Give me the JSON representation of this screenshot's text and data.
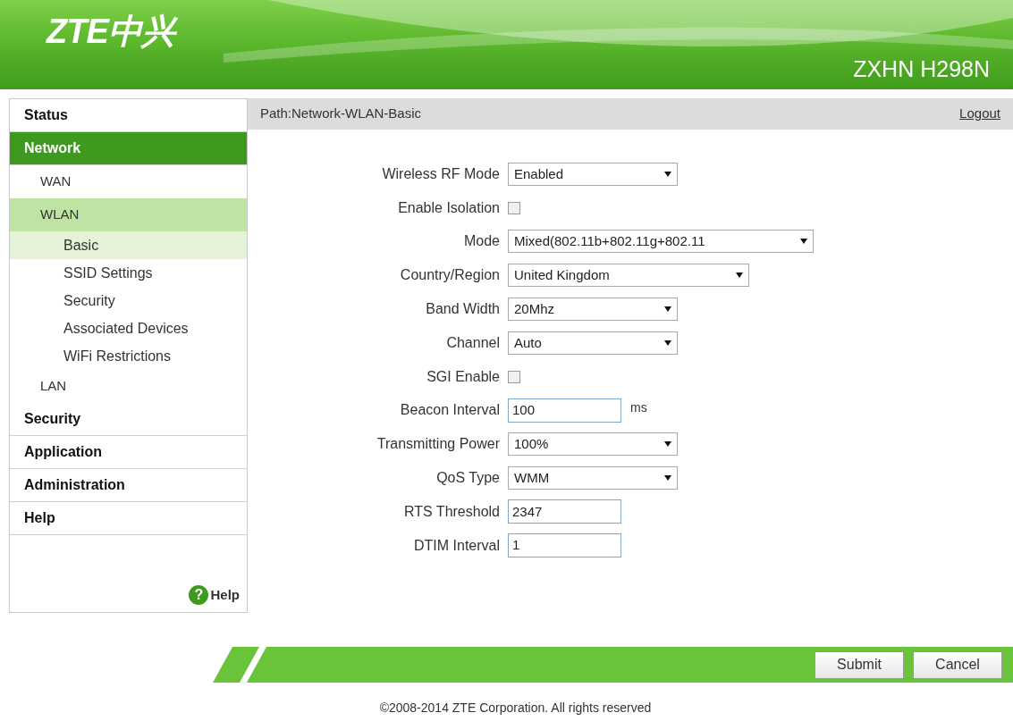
{
  "header": {
    "logo": "ZTE中兴",
    "model": "ZXHN H298N"
  },
  "sidebar": {
    "items": [
      {
        "label": "Status",
        "selected": false
      },
      {
        "label": "Network",
        "selected": true,
        "children": [
          {
            "label": "WAN",
            "selected": false
          },
          {
            "label": "WLAN",
            "selected": true,
            "children": [
              {
                "label": "Basic",
                "selected": true
              },
              {
                "label": "SSID Settings",
                "selected": false
              },
              {
                "label": "Security",
                "selected": false
              },
              {
                "label": "Associated Devices",
                "selected": false
              },
              {
                "label": "WiFi Restrictions",
                "selected": false
              }
            ]
          },
          {
            "label": "LAN",
            "selected": false
          }
        ]
      },
      {
        "label": "Security",
        "selected": false
      },
      {
        "label": "Application",
        "selected": false
      },
      {
        "label": "Administration",
        "selected": false
      },
      {
        "label": "Help",
        "selected": false
      }
    ],
    "help_link": {
      "glyph": "?",
      "label": "Help"
    }
  },
  "path_bar": {
    "path": "Path:Network-WLAN-Basic",
    "logout": "Logout"
  },
  "fields": [
    {
      "kind": "select",
      "label": "Wireless RF Mode",
      "value": "Enabled"
    },
    {
      "kind": "checkbox",
      "label": "Enable Isolation",
      "checked": false
    },
    {
      "kind": "select",
      "label": "Mode",
      "value": "Mixed(802.11b+802.11g+802.11"
    },
    {
      "kind": "select",
      "label": "Country/Region",
      "value": "United Kingdom"
    },
    {
      "kind": "select",
      "label": "Band Width",
      "value": "20Mhz"
    },
    {
      "kind": "select",
      "label": "Channel",
      "value": "Auto"
    },
    {
      "kind": "checkbox",
      "label": "SGI Enable",
      "checked": false
    },
    {
      "kind": "text",
      "label": "Beacon Interval",
      "value": "100",
      "unit": "ms"
    },
    {
      "kind": "select",
      "label": "Transmitting Power",
      "value": "100%"
    },
    {
      "kind": "select",
      "label": "QoS Type",
      "value": "WMM"
    },
    {
      "kind": "text",
      "label": "RTS Threshold",
      "value": "2347"
    },
    {
      "kind": "text",
      "label": "DTIM Interval",
      "value": "1"
    }
  ],
  "buttons": [
    "Submit",
    "Cancel"
  ],
  "footer": "©2008-2014 ZTE Corporation. All rights reserved"
}
